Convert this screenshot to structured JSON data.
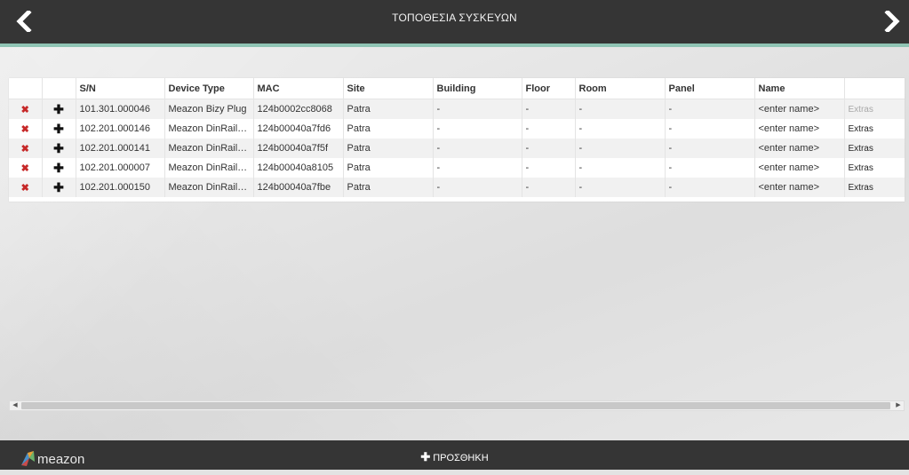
{
  "header": {
    "title": "ΤΟΠΟΘΕΣΙΑ ΣΥΣΚΕΥΩΝ"
  },
  "table": {
    "columns": [
      "",
      "",
      "S/N",
      "Device Type",
      "MAC",
      "Site",
      "Building",
      "Floor",
      "Room",
      "Panel",
      "Name",
      ""
    ],
    "rows": [
      {
        "sn": "101.301.000046",
        "type": "Meazon Bizy Plug",
        "mac": "124b0002cc8068",
        "site": "Patra",
        "building": "-",
        "floor": "-",
        "room": "-",
        "panel": "-",
        "name": "<enter name>",
        "extras": "Extras",
        "extras_disabled": true
      },
      {
        "sn": "102.201.000146",
        "type": "Meazon DinRail 3…",
        "mac": "124b00040a7fd6",
        "site": "Patra",
        "building": "-",
        "floor": "-",
        "room": "-",
        "panel": "-",
        "name": "<enter name>",
        "extras": "Extras",
        "extras_disabled": false
      },
      {
        "sn": "102.201.000141",
        "type": "Meazon DinRail 3…",
        "mac": "124b00040a7f5f",
        "site": "Patra",
        "building": "-",
        "floor": "-",
        "room": "-",
        "panel": "-",
        "name": "<enter name>",
        "extras": "Extras",
        "extras_disabled": false
      },
      {
        "sn": "102.201.000007",
        "type": "Meazon DinRail 3…",
        "mac": "124b00040a8105",
        "site": "Patra",
        "building": "-",
        "floor": "-",
        "room": "-",
        "panel": "-",
        "name": "<enter name>",
        "extras": "Extras",
        "extras_disabled": false
      },
      {
        "sn": "102.201.000150",
        "type": "Meazon DinRail 3…",
        "mac": "124b00040a7fbe",
        "site": "Patra",
        "building": "-",
        "floor": "-",
        "room": "-",
        "panel": "-",
        "name": "<enter name>",
        "extras": "Extras",
        "extras_disabled": false
      }
    ],
    "row_icons": {
      "delete": "close-icon",
      "add": "plus-icon"
    }
  },
  "footer": {
    "logo_text": "meazon",
    "add_button_label": "ΠΡΟΣΘΗΚΗ"
  },
  "colors": {
    "header_bg": "#353535",
    "accent": "#8fc4b4",
    "delete_red": "#c62828"
  }
}
